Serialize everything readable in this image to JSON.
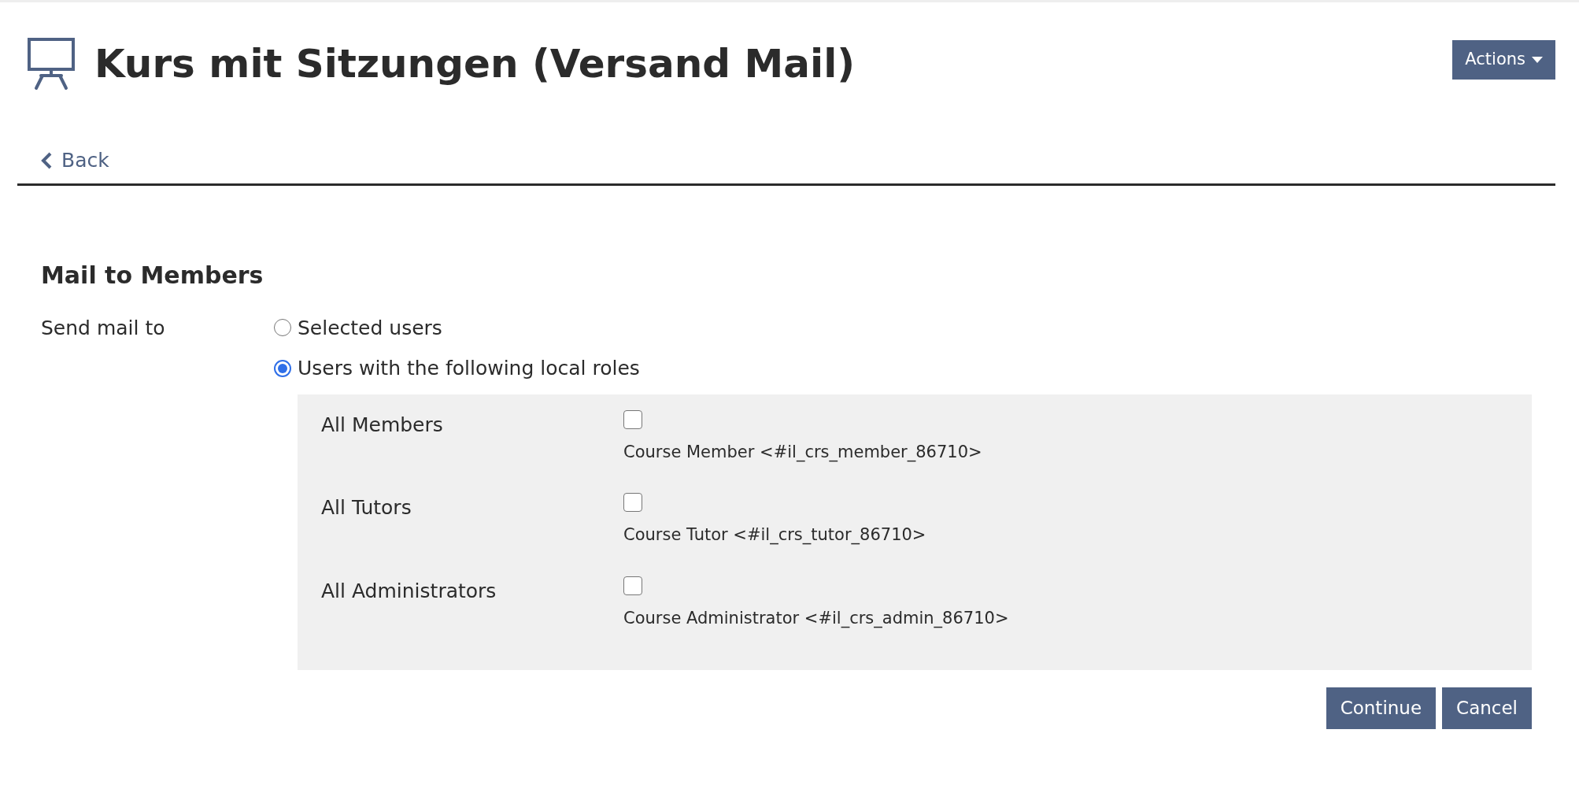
{
  "header": {
    "title": "Kurs mit Sitzungen (Versand Mail)",
    "actions_button": "Actions"
  },
  "back_link": "Back",
  "form": {
    "title": "Mail to Members",
    "field_label": "Send mail to",
    "options": [
      {
        "label": "Selected users",
        "selected": false
      },
      {
        "label": "Users with the following local roles",
        "selected": true
      }
    ],
    "roles": [
      {
        "label": "All Members",
        "checked": false,
        "description": "Course Member <#il_crs_member_86710>"
      },
      {
        "label": "All Tutors",
        "checked": false,
        "description": "Course Tutor <#il_crs_tutor_86710>"
      },
      {
        "label": "All Administrators",
        "checked": false,
        "description": "Course Administrator <#il_crs_admin_86710>"
      }
    ]
  },
  "buttons": [
    "Continue",
    "Cancel"
  ]
}
